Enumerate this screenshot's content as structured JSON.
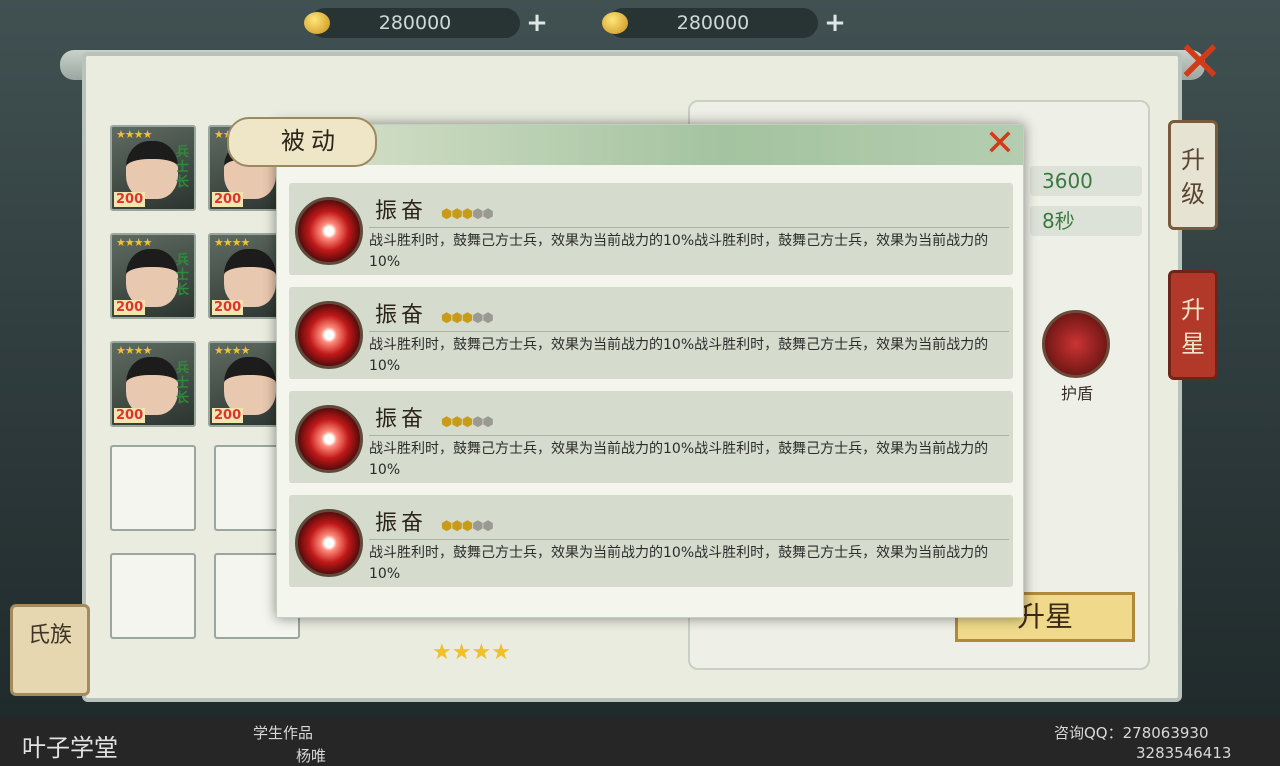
{
  "currency": [
    {
      "amount": "280000"
    },
    {
      "amount": "280000"
    }
  ],
  "side": {
    "upgrade": "升级",
    "upstar": "升星"
  },
  "clan": "氏族",
  "heroes": {
    "stars": "★★★★",
    "level": "200",
    "tag": "兵士长"
  },
  "stats": {
    "value": "3600",
    "time": "8秒"
  },
  "shield": "护盾",
  "upstar_btn": "升星",
  "bottom_stars": "★★★★",
  "overlay": {
    "title": "被动",
    "rows": [
      {
        "name": "振奋",
        "desc": "战斗胜利时，鼓舞己方士兵，效果为当前战力的10%战斗胜利时，鼓舞己方士兵，效果为当前战力的10%"
      },
      {
        "name": "振奋",
        "desc": "战斗胜利时，鼓舞己方士兵，效果为当前战力的10%战斗胜利时，鼓舞己方士兵，效果为当前战力的10%"
      },
      {
        "name": "振奋",
        "desc": "战斗胜利时，鼓舞己方士兵，效果为当前战力的10%战斗胜利时，鼓舞己方士兵，效果为当前战力的10%"
      },
      {
        "name": "振奋",
        "desc": "战斗胜利时，鼓舞己方士兵，效果为当前战力的10%战斗胜利时，鼓舞己方士兵，效果为当前战力的10%"
      }
    ]
  },
  "footer": {
    "logo": "叶子学堂",
    "label": "学生作品",
    "author": "杨唯",
    "qq": "咨询QQ：278063930",
    "qq2": "3283546413"
  }
}
